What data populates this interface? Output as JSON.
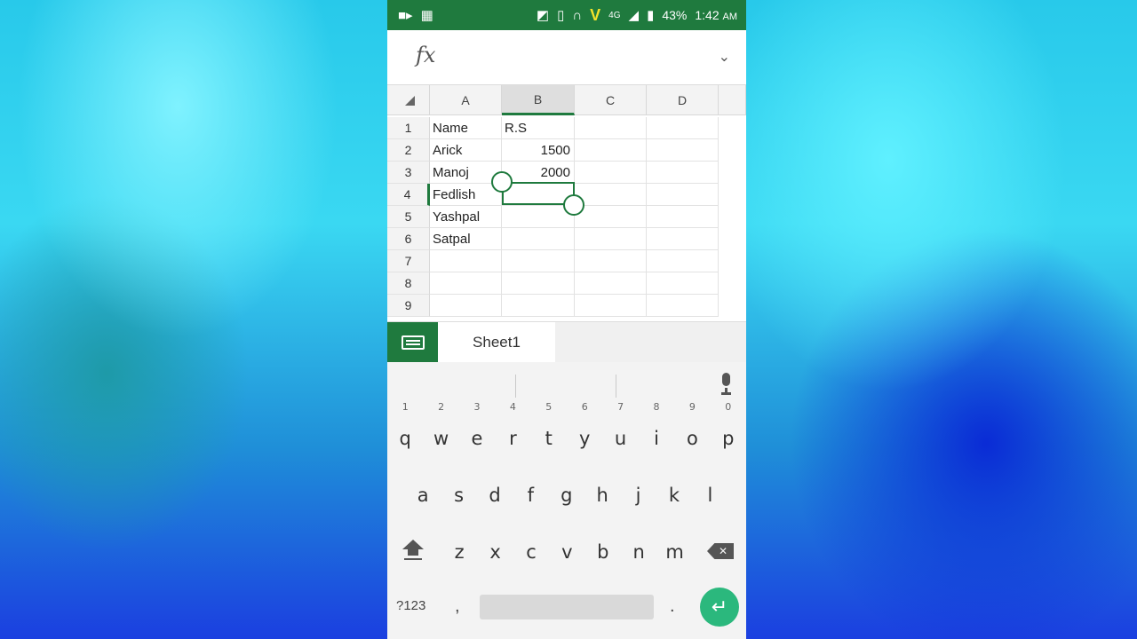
{
  "status_bar": {
    "battery": "43%",
    "time": "1:42",
    "ampm": "AM",
    "network": "4G",
    "carrier_badge": "V"
  },
  "formula_bar": {
    "fx_label": "fx",
    "value": ""
  },
  "grid": {
    "columns": [
      "A",
      "B",
      "C",
      "D"
    ],
    "rows": [
      "1",
      "2",
      "3",
      "4",
      "5",
      "6",
      "7",
      "8",
      "9"
    ],
    "selected_column": "B",
    "selected_row": "4",
    "cells": {
      "A1": "Name",
      "B1": "R.S",
      "A2": "Arick",
      "B2": "1500",
      "A3": "Manoj",
      "B3": "2000",
      "A4": "Fedlish",
      "A5": "Yashpal",
      "A6": "Satpal"
    }
  },
  "sheet_tabs": {
    "active": "Sheet1"
  },
  "keyboard": {
    "row1": [
      "q",
      "w",
      "e",
      "r",
      "t",
      "y",
      "u",
      "i",
      "o",
      "p"
    ],
    "row1_hints": [
      "1",
      "2",
      "3",
      "4",
      "5",
      "6",
      "7",
      "8",
      "9",
      "0"
    ],
    "row2": [
      "a",
      "s",
      "d",
      "f",
      "g",
      "h",
      "j",
      "k",
      "l"
    ],
    "row3": [
      "z",
      "x",
      "c",
      "v",
      "b",
      "n",
      "m"
    ],
    "symbols_label": "?123",
    "comma": ",",
    "period": ".",
    "enter_glyph": "↵",
    "backspace_glyph": "✕"
  },
  "colors": {
    "accent": "#1f7a3e",
    "enter": "#2bb87d"
  }
}
